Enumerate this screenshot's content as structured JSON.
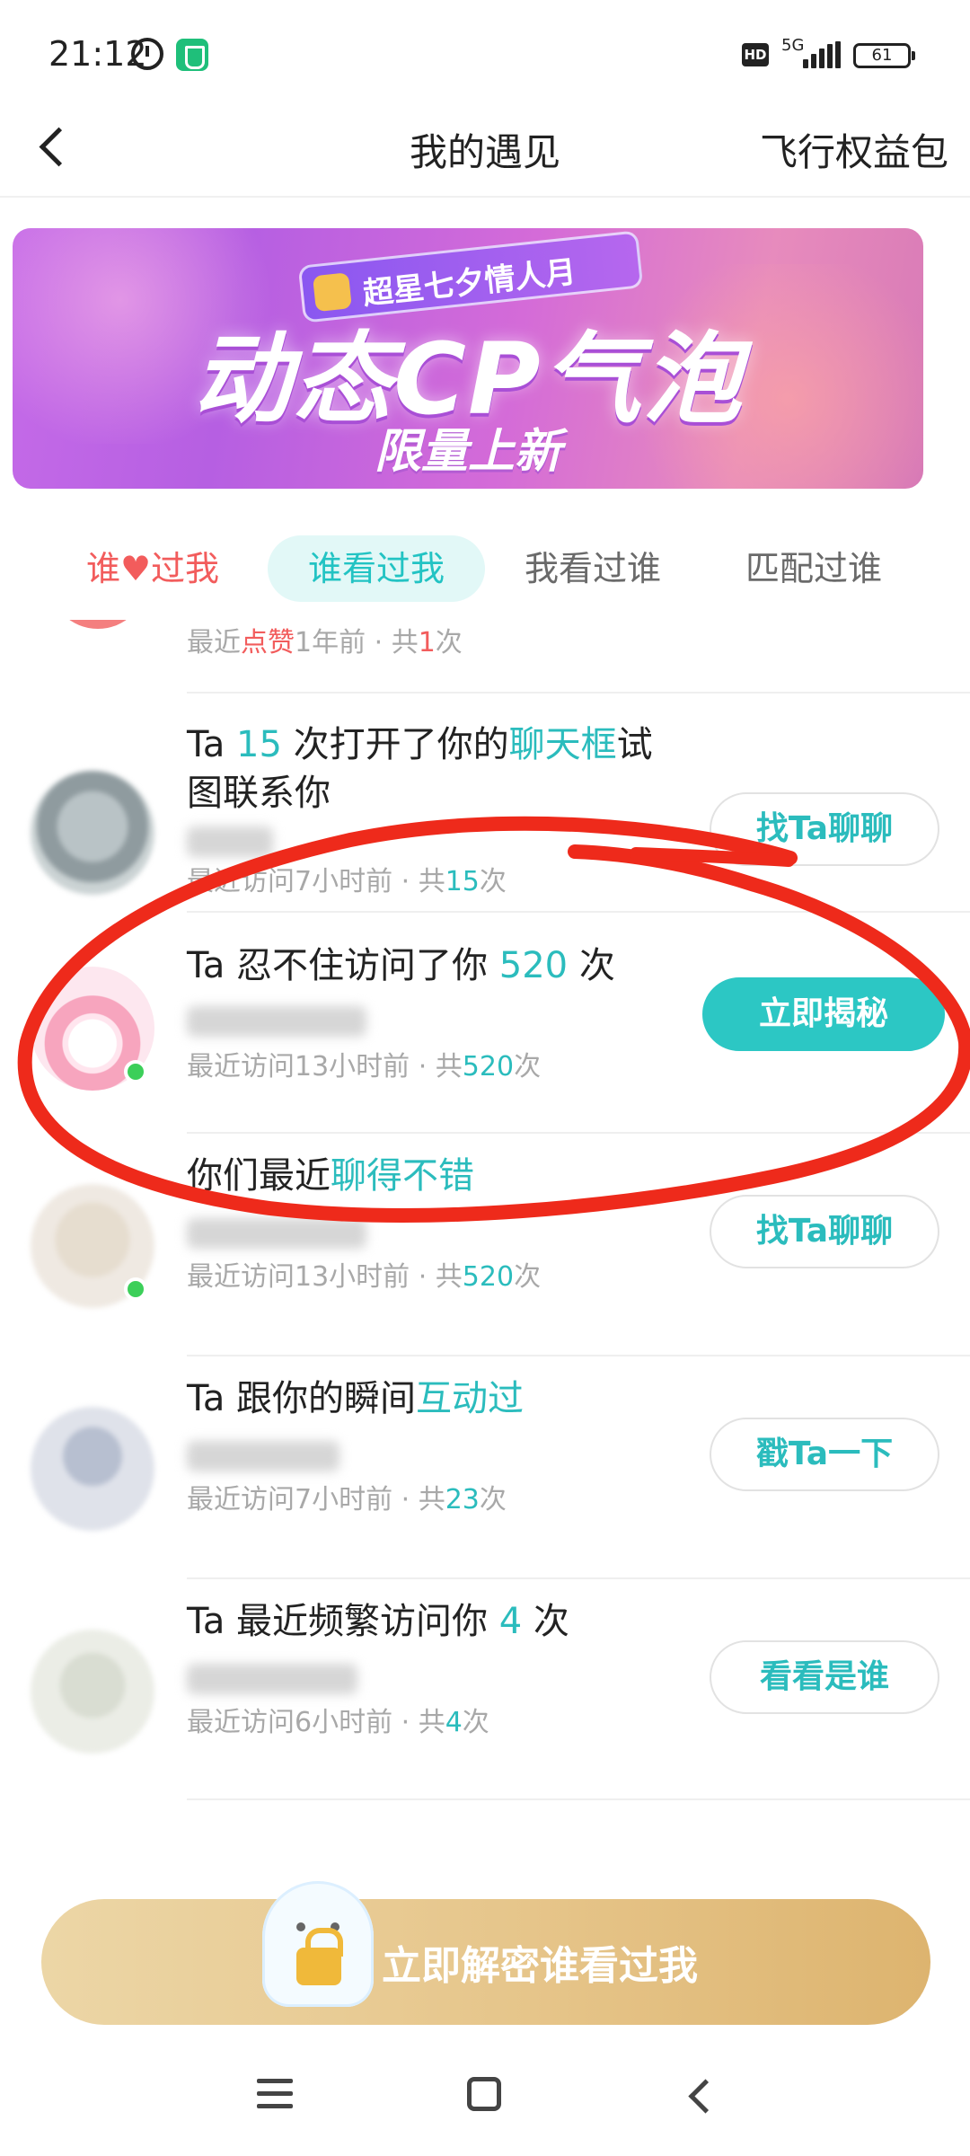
{
  "status": {
    "time": "21:12",
    "hd": "HD",
    "network": "5G",
    "battery": "61"
  },
  "nav": {
    "title": "我的遇见",
    "right_link": "飞行权益包"
  },
  "banner": {
    "tag": "超星七夕情人月",
    "title": "动态CP气泡",
    "subtitle": "限量上新"
  },
  "tabs": [
    {
      "prefix": "谁",
      "suffix": "过我"
    },
    {
      "label": "谁看过我"
    },
    {
      "label": "我看过谁"
    },
    {
      "label": "匹配过谁"
    }
  ],
  "partial_item": {
    "meta_prefix": "最近",
    "meta_like": "点赞",
    "meta_time": "1年前 · 共",
    "meta_count": "1",
    "meta_suffix": "次"
  },
  "items": [
    {
      "title_a": "Ta ",
      "title_hl1": "15",
      "title_b": " 次打开了你的",
      "title_hl2": "聊天框",
      "title_c": "试",
      "title_line2": "图联系你",
      "meta": "最近访问7小时前 · 共",
      "count": "15",
      "suffix": "次",
      "button": "找Ta聊聊"
    },
    {
      "title_a": "Ta 忍不住访问了你 ",
      "title_hl1": "520",
      "title_b": " 次",
      "meta": "最近访问13小时前 · 共",
      "count": "520",
      "suffix": "次",
      "button": "立即揭秘"
    },
    {
      "title_a": "你们最近",
      "title_hl1": "聊得不错",
      "meta": "最近访问13小时前 · 共",
      "count": "520",
      "suffix": "次",
      "button": "找Ta聊聊"
    },
    {
      "title_a": "Ta 跟你的瞬间",
      "title_hl1": "互动过",
      "meta": "最近访问7小时前 · 共",
      "count": "23",
      "suffix": "次",
      "button": "戳Ta一下"
    },
    {
      "title_a": "Ta 最近频繁访问你 ",
      "title_hl1": "4",
      "title_b": " 次",
      "meta": "最近访问6小时前 · 共",
      "count": "4",
      "suffix": "次",
      "button": "看看是谁"
    }
  ],
  "cta": {
    "label": "立即解密谁看过我"
  },
  "colors": {
    "accent": "#2bbcbd",
    "like_red": "#f25c5c",
    "annotation_red": "#ee2a1b",
    "cta_gold": "#e6c58a"
  },
  "icons": [
    "back-arrow-icon",
    "alarm-icon",
    "shield-icon",
    "signal-icon",
    "battery-icon",
    "heart-icon",
    "ghost-lock-icon",
    "menu-icon",
    "home-icon",
    "back-icon"
  ]
}
